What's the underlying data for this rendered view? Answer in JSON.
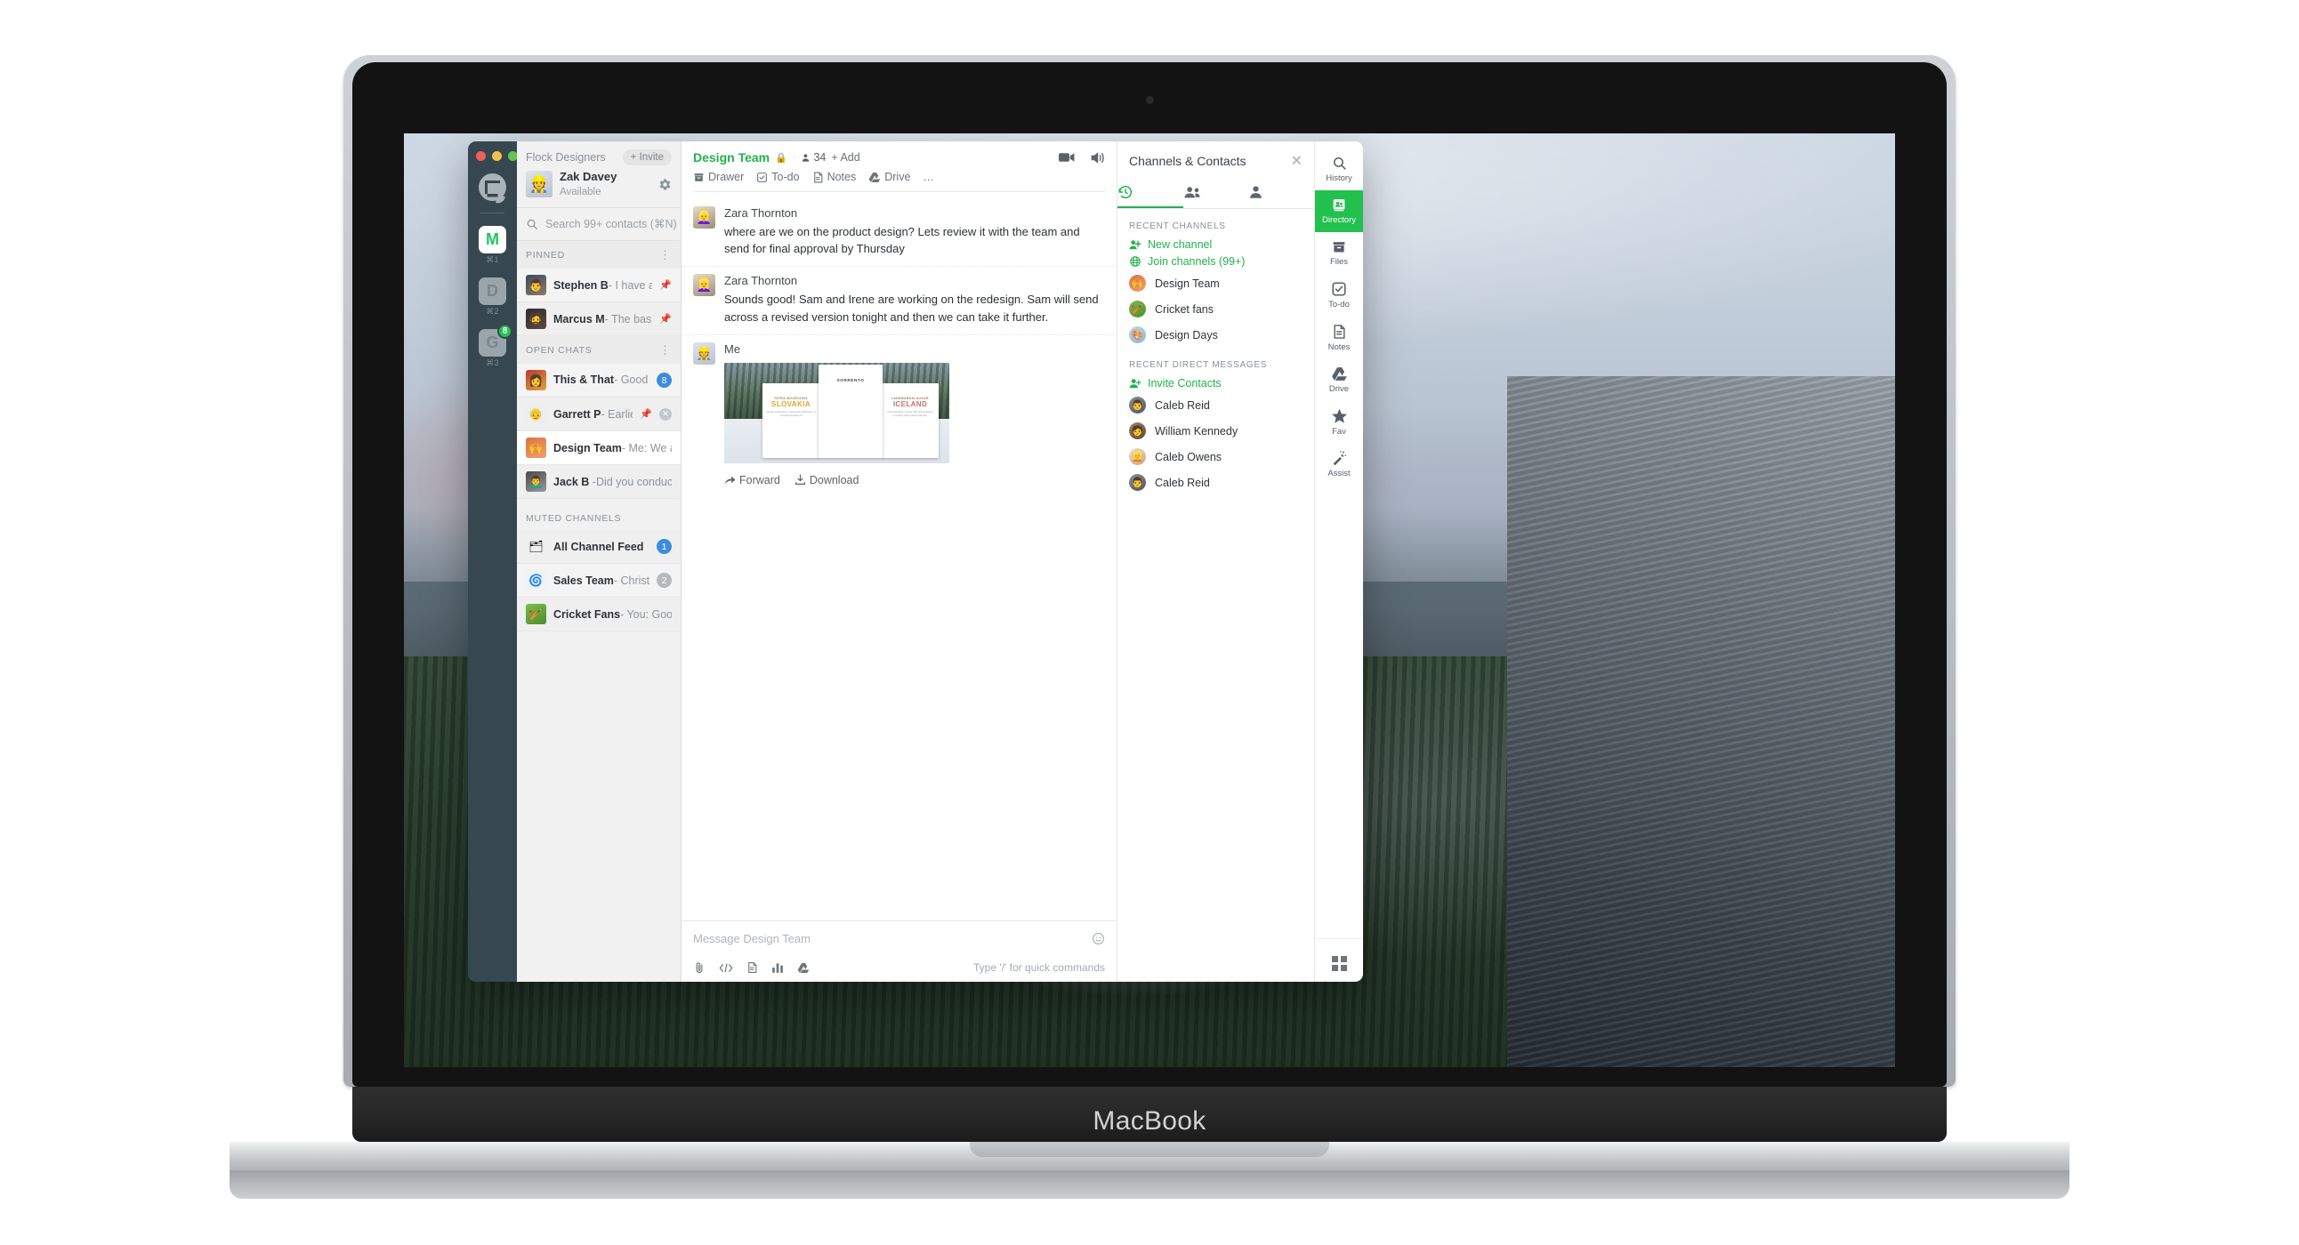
{
  "device": {
    "brand": "MacBook"
  },
  "rail": {
    "logo_icon": "flock-logo-icon",
    "apps": [
      {
        "letter": "M",
        "shortcut": "⌘1",
        "badge": ""
      },
      {
        "letter": "D",
        "shortcut": "⌘2",
        "badge": ""
      },
      {
        "letter": "G",
        "shortcut": "⌘3",
        "badge": "8"
      }
    ]
  },
  "contacts": {
    "team_name": "Flock Designers",
    "invite_label": "+ Invite",
    "me": {
      "name": "Zak Davey",
      "status": "Available",
      "avatar_emoji": "👷",
      "gear_icon": "gear-icon"
    },
    "search": {
      "placeholder": "Search 99+ contacts (⌘N)",
      "value": "",
      "icon": "search-icon",
      "add_icon": "plus-icon"
    },
    "sections": [
      {
        "label": "PINNED",
        "rows": [
          {
            "name": "Stephen B",
            "preview": "- I have a thing for",
            "avatar_emoji": "👨",
            "pinned": true,
            "badge": "",
            "badge_color": ""
          },
          {
            "name": "Marcus M",
            "preview": "- The basic proc…",
            "avatar_emoji": "🧔",
            "pinned": true,
            "badge": "",
            "badge_color": ""
          }
        ]
      },
      {
        "label": "OPEN CHATS",
        "rows": [
          {
            "name": "This & That",
            "preview": "- Good job👏…",
            "avatar_emoji": "👩",
            "pinned": false,
            "badge": "8",
            "badge_color": "blue"
          },
          {
            "name": "Garrett P",
            "preview": "- Earlier this…",
            "avatar_emoji": "👴",
            "pinned": true,
            "badge": "x",
            "badge_color": ""
          },
          {
            "name": "Design Team",
            "preview": "- Me: We are re…",
            "avatar_emoji": "🙌",
            "pinned": false,
            "badge": "",
            "badge_color": "",
            "selected": true
          },
          {
            "name": "Jack B ",
            "preview": "-Did you conduct any sur",
            "avatar_emoji": "👨‍🦱",
            "pinned": false,
            "badge": "",
            "badge_color": ""
          }
        ]
      },
      {
        "label": "MUTED CHANNELS",
        "rows": [
          {
            "name": "All Channel Feed",
            "preview": "",
            "avatar_emoji": "🗂",
            "pinned": false,
            "badge": "1",
            "badge_color": "blue"
          },
          {
            "name": "Sales Team",
            "preview": "- Christopher J:",
            "avatar_emoji": "🌀",
            "pinned": false,
            "badge": "2",
            "badge_color": "grey"
          },
          {
            "name": "Cricket Fans",
            "preview": "- You: Good game",
            "avatar_emoji": "🏏",
            "pinned": false,
            "badge": "",
            "badge_color": ""
          }
        ]
      }
    ]
  },
  "conversation": {
    "title": "Design Team",
    "lock_icon": "lock-icon",
    "member_count": "34",
    "members_icon": "person-icon",
    "add_label": "+ Add",
    "actions": [
      {
        "label": "Drawer",
        "icon": "drawer-icon"
      },
      {
        "label": "To-do",
        "icon": "checkbox-icon"
      },
      {
        "label": "Notes",
        "icon": "note-icon"
      },
      {
        "label": "Drive",
        "icon": "drive-icon"
      },
      {
        "label": "…",
        "icon": "more-icon"
      }
    ],
    "header_right": [
      {
        "icon": "video-camera-icon"
      },
      {
        "icon": "speaker-icon"
      }
    ],
    "messages": [
      {
        "author": "Zara Thornton",
        "avatar_emoji": "👱‍♀️",
        "text": "where are we on the product design? Lets review it with the team and send for final approval by Thursday",
        "attachment": null
      },
      {
        "author": "Zara Thornton",
        "avatar_emoji": "👱‍♀️",
        "text": "Sounds good! Sam and Irene are working on the redesign. Sam will send across a revised version tonight and then we can take it further.",
        "attachment": null
      },
      {
        "author": "Me",
        "avatar_emoji": "👷",
        "text": "",
        "attachment": {
          "type": "image",
          "alt": "travel postcards collage",
          "postcards": [
            {
              "kicker": "TATRA MOUNTAINS",
              "title": "SLOVAKIA",
              "body": "Aenean elementum malesuada sollicitudin. In vehicula faucibus mi"
            },
            {
              "kicker": "",
              "title": "SORRENTO",
              "body": ""
            },
            {
              "kicker": "LANDMANNALAUGAR",
              "title": "ICELAND",
              "body": "Cras bibendum cursus nibh luctus blandit. Curabitur tellus sapien dapibus"
            }
          ],
          "actions": [
            {
              "label": "Forward",
              "icon": "forward-arrow-icon"
            },
            {
              "label": "Download",
              "icon": "download-icon"
            }
          ]
        }
      }
    ],
    "composer": {
      "placeholder": "Message Design Team",
      "value": "",
      "emoji_icon": "smiley-icon",
      "hint": "Type '/' for quick commands",
      "tools": [
        {
          "icon": "attachment-icon"
        },
        {
          "icon": "code-snippet-icon"
        },
        {
          "icon": "document-icon"
        },
        {
          "icon": "poll-icon"
        },
        {
          "icon": "drive-icon"
        }
      ]
    }
  },
  "right_panel": {
    "title": "Channels & Contacts",
    "close_icon": "close-icon",
    "tabs": [
      {
        "icon": "history-clock-icon",
        "active": true
      },
      {
        "icon": "group-people-icon",
        "active": false
      },
      {
        "icon": "single-person-icon",
        "active": false
      }
    ],
    "sections": [
      {
        "label": "RECENT CHANNELS",
        "links": [
          {
            "label": "New channel",
            "icon": "add-group-icon"
          },
          {
            "label": "Join channels (99+)",
            "icon": "globe-icon"
          }
        ],
        "items": [
          {
            "name": "Design Team",
            "avatar_emoji": "🙌"
          },
          {
            "name": "Cricket fans",
            "avatar_emoji": "🏏"
          },
          {
            "name": "Design Days",
            "avatar_emoji": "🎨"
          }
        ]
      },
      {
        "label": "RECENT DIRECT MESSAGES",
        "links": [
          {
            "label": "Invite Contacts",
            "icon": "add-person-icon"
          }
        ],
        "items": [
          {
            "name": "Caleb Reid",
            "avatar_emoji": "👨"
          },
          {
            "name": "William Kennedy",
            "avatar_emoji": "🧑"
          },
          {
            "name": "Caleb Owens",
            "avatar_emoji": "👱"
          },
          {
            "name": "Caleb Reid",
            "avatar_emoji": "👨"
          }
        ]
      }
    ]
  },
  "right_toolbar": {
    "items": [
      {
        "label": "History",
        "icon": "search-icon",
        "active": false
      },
      {
        "label": "Directory",
        "icon": "directory-icon",
        "active": true
      },
      {
        "label": "Files",
        "icon": "files-box-icon",
        "active": false
      },
      {
        "label": "To-do",
        "icon": "checkbox-icon",
        "active": false
      },
      {
        "label": "Notes",
        "icon": "note-icon",
        "active": false
      },
      {
        "label": "Drive",
        "icon": "drive-icon",
        "active": false
      },
      {
        "label": "Fav",
        "icon": "star-icon",
        "active": false
      },
      {
        "label": "Assist",
        "icon": "magic-wand-icon",
        "active": false
      }
    ],
    "bottom": {
      "icon": "apps-grid-icon"
    }
  },
  "colors": {
    "accent_green": "#22b24c",
    "active_green": "#22c04f",
    "rail_dark": "#36474f",
    "badge_blue": "#3d8ddd",
    "badge_grey": "#b3b9be"
  }
}
